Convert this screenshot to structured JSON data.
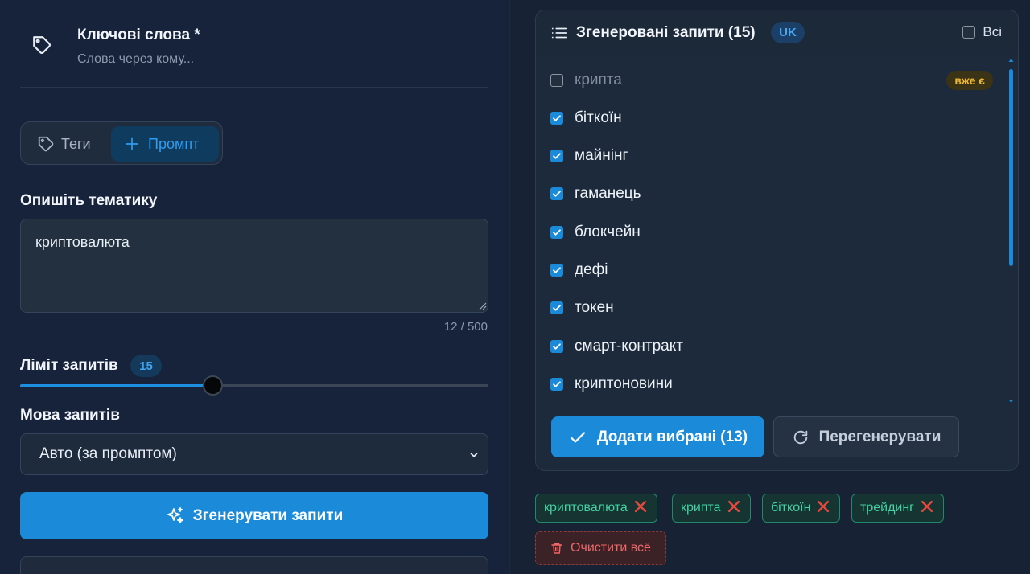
{
  "keywords": {
    "title": "Ключові слова *",
    "subtitle": "Слова через кому..."
  },
  "mode": {
    "tags_label": "Теги",
    "prompt_label": "Промпт",
    "active": "prompt"
  },
  "topic": {
    "label": "Опишіть тематику",
    "value": "криптовалюта",
    "counter": "12 / 500"
  },
  "limit": {
    "label": "Ліміт запитів",
    "value": "15",
    "fraction": 0.41
  },
  "language": {
    "label": "Мова запитів",
    "selected": "Авто (за промптом)"
  },
  "generate_button": "Згенерувати запити",
  "generated": {
    "title": "Згенеровані запити (15)",
    "lang_badge": "UK",
    "select_all_label": "Всі",
    "items": [
      {
        "text": "крипта",
        "checked": false,
        "badge": "вже є"
      },
      {
        "text": "біткоїн",
        "checked": true,
        "badge": ""
      },
      {
        "text": "майнінг",
        "checked": true,
        "badge": ""
      },
      {
        "text": "гаманець",
        "checked": true,
        "badge": ""
      },
      {
        "text": "блокчейн",
        "checked": true,
        "badge": ""
      },
      {
        "text": "дефі",
        "checked": true,
        "badge": ""
      },
      {
        "text": "токен",
        "checked": true,
        "badge": ""
      },
      {
        "text": "смарт-контракт",
        "checked": true,
        "badge": ""
      },
      {
        "text": "криптоновини",
        "checked": true,
        "badge": ""
      }
    ],
    "add_button": "Додати вибрані (13)",
    "regen_button": "Перегенерувати"
  },
  "selected_tags": [
    "криптовалюта",
    "крипта",
    "біткоїн",
    "трейдинг"
  ],
  "clear_button": "Очистити всё",
  "colors": {
    "accent": "#1a8ad9",
    "tag_green": "#44d1a4",
    "warning": "#f0b830",
    "danger": "#f06767"
  }
}
